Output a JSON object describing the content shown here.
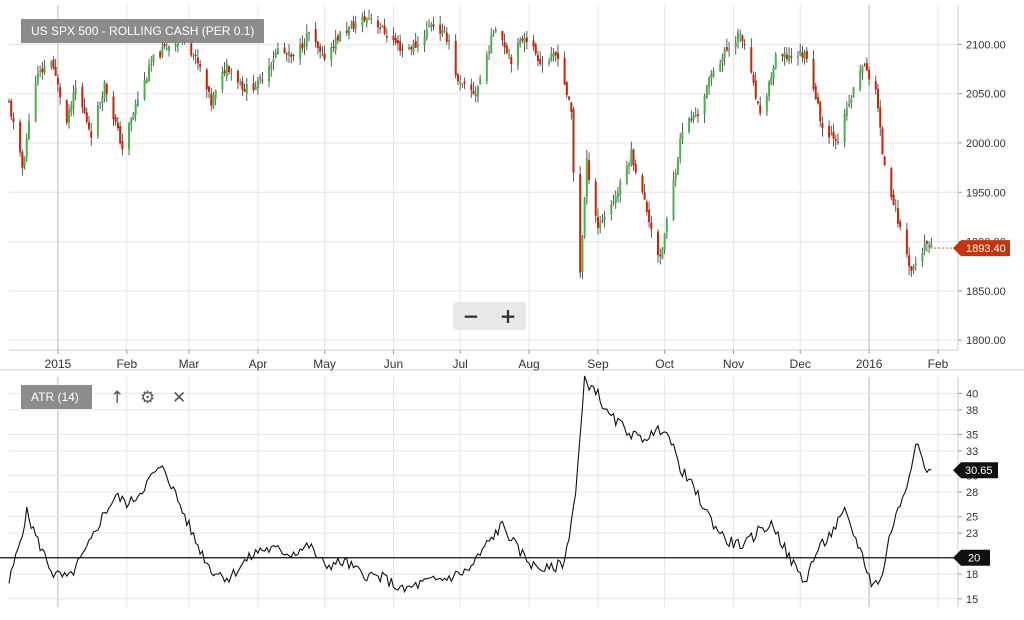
{
  "chart_data": [
    {
      "type": "candlestick",
      "title": "US SPX 500 - ROLLING CASH (PER 0.1)",
      "ylim": [
        1790,
        2140
      ],
      "y_ticks": [
        "2100.00",
        "2050.00",
        "2000.00",
        "1950.00",
        "1900.00",
        "1850.00",
        "1800.00"
      ],
      "y_tick_values": [
        2100,
        2050,
        2000,
        1950,
        1900,
        1850,
        1800
      ],
      "x_ticks": [
        "2015",
        "Feb",
        "Mar",
        "Apr",
        "May",
        "Jun",
        "Jul",
        "Aug",
        "Sep",
        "Oct",
        "Nov",
        "Dec",
        "2016",
        "Feb"
      ],
      "x_tick_dates": [
        "2015-01-01",
        "2015-02-01",
        "2015-03-01",
        "2015-04-01",
        "2015-05-01",
        "2015-06-01",
        "2015-07-01",
        "2015-08-01",
        "2015-09-01",
        "2015-10-01",
        "2015-11-01",
        "2015-12-01",
        "2016-01-01",
        "2016-02-01"
      ],
      "x_range": [
        "2014-12-10",
        "2016-02-10"
      ],
      "last_price_label": "1893.40",
      "last_price": 1893.4,
      "close_path": [
        [
          "2014-12-10",
          2040
        ],
        [
          "2014-12-16",
          1975
        ],
        [
          "2014-12-22",
          2065
        ],
        [
          "2014-12-29",
          2085
        ],
        [
          "2015-01-05",
          2020
        ],
        [
          "2015-01-09",
          2055
        ],
        [
          "2015-01-16",
          2010
        ],
        [
          "2015-01-22",
          2060
        ],
        [
          "2015-01-30",
          1995
        ],
        [
          "2015-02-06",
          2045
        ],
        [
          "2015-02-13",
          2085
        ],
        [
          "2015-02-20",
          2100
        ],
        [
          "2015-02-27",
          2108
        ],
        [
          "2015-03-06",
          2075
        ],
        [
          "2015-03-11",
          2040
        ],
        [
          "2015-03-18",
          2080
        ],
        [
          "2015-03-26",
          2055
        ],
        [
          "2015-04-01",
          2060
        ],
        [
          "2015-04-10",
          2095
        ],
        [
          "2015-04-17",
          2085
        ],
        [
          "2015-04-24",
          2112
        ],
        [
          "2015-04-30",
          2085
        ],
        [
          "2015-05-08",
          2110
        ],
        [
          "2015-05-18",
          2125
        ],
        [
          "2015-05-22",
          2128
        ],
        [
          "2015-05-29",
          2110
        ],
        [
          "2015-06-05",
          2095
        ],
        [
          "2015-06-12",
          2100
        ],
        [
          "2015-06-18",
          2122
        ],
        [
          "2015-06-26",
          2105
        ],
        [
          "2015-06-30",
          2060
        ],
        [
          "2015-07-08",
          2050
        ],
        [
          "2015-07-17",
          2120
        ],
        [
          "2015-07-24",
          2085
        ],
        [
          "2015-07-30",
          2110
        ],
        [
          "2015-08-07",
          2080
        ],
        [
          "2015-08-14",
          2090
        ],
        [
          "2015-08-20",
          2030
        ],
        [
          "2015-08-21",
          1970
        ],
        [
          "2015-08-24",
          1870
        ],
        [
          "2015-08-27",
          1980
        ],
        [
          "2015-09-01",
          1915
        ],
        [
          "2015-09-10",
          1950
        ],
        [
          "2015-09-16",
          1990
        ],
        [
          "2015-09-22",
          1940
        ],
        [
          "2015-09-29",
          1880
        ],
        [
          "2015-10-09",
          2015
        ],
        [
          "2015-10-16",
          2030
        ],
        [
          "2015-10-23",
          2075
        ],
        [
          "2015-11-03",
          2110
        ],
        [
          "2015-11-06",
          2100
        ],
        [
          "2015-11-13",
          2025
        ],
        [
          "2015-11-20",
          2085
        ],
        [
          "2015-11-30",
          2090
        ],
        [
          "2015-12-04",
          2090
        ],
        [
          "2015-12-11",
          2015
        ],
        [
          "2015-12-18",
          2005
        ],
        [
          "2015-12-29",
          2080
        ],
        [
          "2016-01-04",
          2055
        ],
        [
          "2016-01-07",
          1990
        ],
        [
          "2016-01-13",
          1930
        ],
        [
          "2016-01-20",
          1870
        ],
        [
          "2016-01-26",
          1895
        ],
        [
          "2016-01-29",
          1893.4
        ]
      ]
    },
    {
      "type": "line",
      "title": "ATR (14)",
      "ylim": [
        14,
        42
      ],
      "y_ticks": [
        "40",
        "38",
        "35",
        "33",
        "30",
        "28",
        "25",
        "23",
        "20",
        "18",
        "15"
      ],
      "y_tick_values": [
        40,
        38,
        35,
        33,
        30,
        28,
        25,
        23,
        20,
        18,
        15
      ],
      "reference_line": 20,
      "reference_label": "20",
      "last_value_label": "30.65",
      "last_value": 30.65,
      "x_range": [
        "2014-12-10",
        "2016-02-10"
      ],
      "points": [
        [
          "2014-12-10",
          17
        ],
        [
          "2014-12-14",
          21
        ],
        [
          "2014-12-18",
          25.5
        ],
        [
          "2014-12-23",
          22
        ],
        [
          "2014-12-30",
          18
        ],
        [
          "2015-01-06",
          17.5
        ],
        [
          "2015-01-14",
          21
        ],
        [
          "2015-01-21",
          25
        ],
        [
          "2015-01-27",
          27.5
        ],
        [
          "2015-02-02",
          26.5
        ],
        [
          "2015-02-07",
          28
        ],
        [
          "2015-02-14",
          30.5
        ],
        [
          "2015-02-18",
          30.8
        ],
        [
          "2015-02-24",
          27
        ],
        [
          "2015-03-04",
          22
        ],
        [
          "2015-03-11",
          18.5
        ],
        [
          "2015-03-19",
          17.5
        ],
        [
          "2015-03-26",
          19.5
        ],
        [
          "2015-04-02",
          21
        ],
        [
          "2015-04-09",
          21
        ],
        [
          "2015-04-16",
          20.5
        ],
        [
          "2015-04-24",
          21.5
        ],
        [
          "2015-05-01",
          19
        ],
        [
          "2015-05-10",
          19.5
        ],
        [
          "2015-05-18",
          18
        ],
        [
          "2015-05-28",
          17.5
        ],
        [
          "2015-06-05",
          16
        ],
        [
          "2015-06-15",
          17
        ],
        [
          "2015-06-25",
          17.5
        ],
        [
          "2015-07-05",
          18.5
        ],
        [
          "2015-07-14",
          22
        ],
        [
          "2015-07-20",
          24
        ],
        [
          "2015-07-27",
          21
        ],
        [
          "2015-08-03",
          19
        ],
        [
          "2015-08-10",
          18.5
        ],
        [
          "2015-08-17",
          19.5
        ],
        [
          "2015-08-22",
          28
        ],
        [
          "2015-08-26",
          41.5
        ],
        [
          "2015-08-31",
          40.5
        ],
        [
          "2015-09-05",
          37.5
        ],
        [
          "2015-09-12",
          36
        ],
        [
          "2015-09-19",
          34.5
        ],
        [
          "2015-09-26",
          35
        ],
        [
          "2015-10-01",
          36
        ],
        [
          "2015-10-08",
          31
        ],
        [
          "2015-10-15",
          28
        ],
        [
          "2015-10-22",
          24.5
        ],
        [
          "2015-10-29",
          22
        ],
        [
          "2015-11-06",
          21.5
        ],
        [
          "2015-11-13",
          23.5
        ],
        [
          "2015-11-19",
          24
        ],
        [
          "2015-11-25",
          20.5
        ],
        [
          "2015-12-03",
          17
        ],
        [
          "2015-12-08",
          20.5
        ],
        [
          "2015-12-15",
          23
        ],
        [
          "2015-12-21",
          25.5
        ],
        [
          "2015-12-28",
          21
        ],
        [
          "2016-01-02",
          17
        ],
        [
          "2016-01-06",
          17
        ],
        [
          "2016-01-11",
          23.5
        ],
        [
          "2016-01-15",
          26.5
        ],
        [
          "2016-01-19",
          30
        ],
        [
          "2016-01-22",
          34.5
        ],
        [
          "2016-01-26",
          31
        ],
        [
          "2016-01-29",
          30.65
        ]
      ]
    }
  ],
  "price_panel": {
    "title": "US SPX 500 - ROLLING CASH (PER 0.1)",
    "zoom_out_label": "−",
    "zoom_in_label": "+"
  },
  "atr_panel": {
    "title": "ATR (14)",
    "icons": [
      "arrow-up-icon",
      "gear-icon",
      "close-icon"
    ],
    "arrow_glyph": "↑",
    "gear_glyph": "⚙",
    "close_glyph": "✕"
  },
  "colors": {
    "up_candle": "#4caf50",
    "down_candle": "#cc2200",
    "neutral_candle": "#333333",
    "price_badge": "#c0350e",
    "atr_line": "#111111",
    "atr_badge": "#111111",
    "grid": "#e6e6e6",
    "axis_text": "#333333"
  }
}
